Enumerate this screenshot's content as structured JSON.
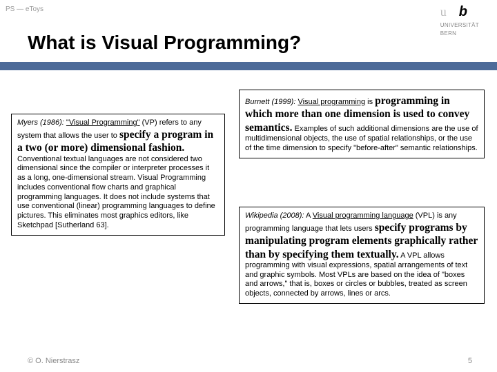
{
  "breadcrumb": "PS — eToys",
  "logo": {
    "u": "u",
    "b": "b",
    "sub1": "UNIVERSITÄT",
    "sub2": "BERN"
  },
  "title": "What is Visual Programming?",
  "boxLeft": {
    "lead_it": "Myers (1986):",
    "lead_ul": "\"Visual Programming\"",
    "lead_tail": " (VP) refers to any system that allows the user to ",
    "big": "specify a program in a two (or more) dimensional fashion.",
    "rest": " Conventional textual languages are not considered two dimensional since the compiler or interpreter processes it as a long, one-dimensional stream. Visual Programming includes conventional flow charts and graphical programming languages. It does not include systems that use conventional (linear) programming languages to define pictures. This eliminates most graphics editors, like Sketchpad [Sutherland 63]."
  },
  "boxRight1": {
    "lead_it": "Burnett (1999):",
    "lead_ul": " Visual programming",
    "lead_tail": " is ",
    "big": "programming in which more than one dimension is used to convey semantics.",
    "rest": " Examples of such additional dimensions are the use of multidimensional objects, the use of spatial relationships, or the use of the time dimension to specify \"before-after\" semantic relationships."
  },
  "boxRight2": {
    "lead_it": "Wikipedia (2008):",
    "lead_pre": " A ",
    "lead_ul": "Visual programming language",
    "lead_tail": " (VPL) is any programming language that lets users ",
    "big": "specify programs by manipulating program elements graphically rather than by specifying them textually.",
    "rest": " A VPL allows programming with visual expressions, spatial arrangements of text and graphic symbols. Most VPLs are based on the idea of \"boxes and arrows,\" that is, boxes or circles or bubbles, treated as screen objects, connected by arrows, lines or arcs."
  },
  "footerLeft": "© O. Nierstrasz",
  "footerRight": "5"
}
